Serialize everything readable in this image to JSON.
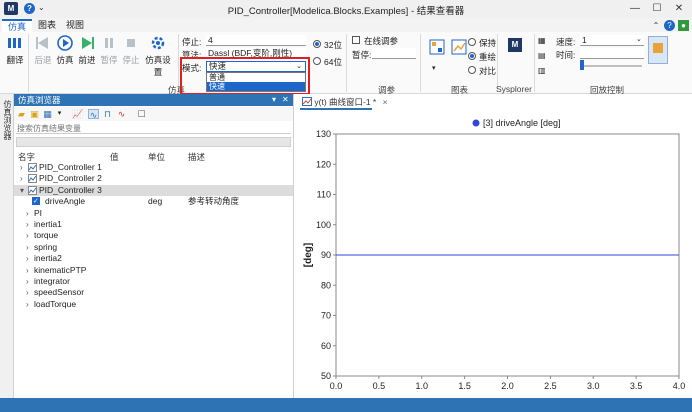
{
  "window": {
    "title": "PID_Controller[Modelica.Blocks.Examples] - 结果查看器",
    "logo": "M",
    "help": "?"
  },
  "tabs": [
    {
      "label": "仿真",
      "active": true
    },
    {
      "label": "图表",
      "active": false
    },
    {
      "label": "视图",
      "active": false
    }
  ],
  "ribbon": {
    "buttons": {
      "translate": "翻译",
      "back": "后退",
      "simulate": "仿真",
      "forward": "前进",
      "pause": "暂停",
      "stop": "停止",
      "sim_settings": "仿真设置"
    },
    "group_simulate": "仿真",
    "stop_time_label": "停止:",
    "stop_time_value": "4",
    "algorithm_label": "算法:",
    "algorithm_value": "Dassl (BDF,变阶,刚性)",
    "mode_label": "模式:",
    "mode_value": "快速",
    "mode_options": [
      "普通",
      "快速"
    ],
    "bits_32": "32位",
    "bits_64": "64位",
    "online_tuning": "在线调参",
    "pause_label": "暂停:",
    "group_tuning": "调参",
    "hold": "保持",
    "overlay": "重绘",
    "compare": "对比",
    "group_chart": "图表",
    "sysplorer": "Sysplorer",
    "speed_label": "速度:",
    "speed_value": "1",
    "time_label": "时间:",
    "time_value": "",
    "group_playback": "回放控制"
  },
  "left_strip": {
    "label": "仿真浏览器"
  },
  "browser": {
    "title": "仿真浏览器",
    "search_placeholder": "搜索仿真结果变量",
    "columns": [
      "名字",
      "值",
      "单位",
      "描述"
    ],
    "rows": [
      {
        "name": "PID_Controller 1",
        "value": "",
        "unit": "",
        "desc": "",
        "level": 0,
        "type": "result"
      },
      {
        "name": "PID_Controller 2",
        "value": "",
        "unit": "",
        "desc": "",
        "level": 0,
        "type": "result"
      },
      {
        "name": "PID_Controller 3",
        "value": "",
        "unit": "",
        "desc": "",
        "level": 0,
        "type": "result",
        "selected": true,
        "expanded": true
      },
      {
        "name": "driveAngle",
        "value": "",
        "unit": "deg",
        "desc": "参考转动角度",
        "level": 1,
        "type": "checked"
      },
      {
        "name": "PI",
        "value": "",
        "unit": "",
        "desc": "",
        "level": 1,
        "type": "node"
      },
      {
        "name": "inertia1",
        "value": "",
        "unit": "",
        "desc": "",
        "level": 1,
        "type": "node"
      },
      {
        "name": "torque",
        "value": "",
        "unit": "",
        "desc": "",
        "level": 1,
        "type": "node"
      },
      {
        "name": "spring",
        "value": "",
        "unit": "",
        "desc": "",
        "level": 1,
        "type": "node"
      },
      {
        "name": "inertia2",
        "value": "",
        "unit": "",
        "desc": "",
        "level": 1,
        "type": "node"
      },
      {
        "name": "kinematicPTP",
        "value": "",
        "unit": "",
        "desc": "",
        "level": 1,
        "type": "node"
      },
      {
        "name": "integrator",
        "value": "",
        "unit": "",
        "desc": "",
        "level": 1,
        "type": "node"
      },
      {
        "name": "speedSensor",
        "value": "",
        "unit": "",
        "desc": "",
        "level": 1,
        "type": "node"
      },
      {
        "name": "loadTorque",
        "value": "",
        "unit": "",
        "desc": "",
        "level": 1,
        "type": "node"
      }
    ]
  },
  "plot": {
    "tab_label": "y(t) 曲线窗口-1 *",
    "close": "×"
  },
  "colors": {
    "accent": "#1e66c8",
    "header_blue": "#2e74b5",
    "series": "#3344dd",
    "highlight_red": "#e02020"
  },
  "chart_data": {
    "type": "line",
    "title": "",
    "xlabel": "",
    "ylabel": "[deg]",
    "xlim": [
      0,
      4
    ],
    "ylim": [
      50,
      130
    ],
    "xticks": [
      "0.0",
      "0.5",
      "1.0",
      "1.5",
      "2.0",
      "2.5",
      "3.0",
      "3.5",
      "4.0"
    ],
    "yticks": [
      "50",
      "60",
      "70",
      "80",
      "90",
      "100",
      "110",
      "120",
      "130"
    ],
    "legend": "top-center",
    "grid": false,
    "series": [
      {
        "name": "[3] driveAngle [deg]",
        "x": [
          0,
          4
        ],
        "y": [
          90,
          90
        ],
        "color": "#3344dd"
      }
    ]
  }
}
